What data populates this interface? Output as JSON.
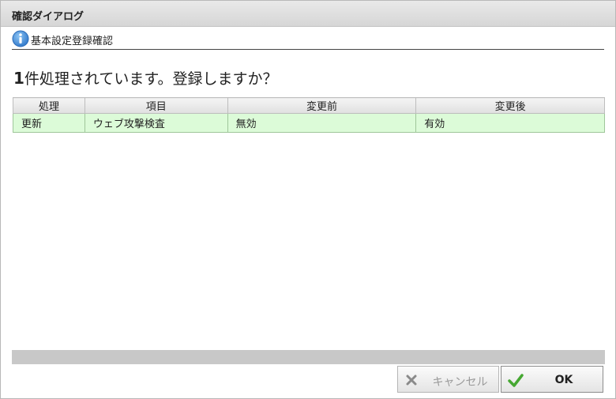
{
  "dialog": {
    "title": "確認ダイアログ"
  },
  "section": {
    "icon": "info-icon",
    "label": "基本設定登録確認"
  },
  "message": {
    "count": "1",
    "text": "件処理されています。登録しますか？"
  },
  "table": {
    "headers": [
      "処理",
      "項目",
      "変更前",
      "変更後"
    ],
    "rows": [
      [
        "更新",
        "ウェブ攻撃検査",
        "無効",
        "有効"
      ]
    ]
  },
  "buttons": {
    "cancel": {
      "label": "キャンセル",
      "icon": "close-icon"
    },
    "ok": {
      "label": "OK",
      "icon": "check-icon"
    }
  },
  "colors": {
    "row_highlight": "#dcfbd8",
    "info_icon": "#4a8fd8",
    "ok_check": "#4caf3a"
  }
}
